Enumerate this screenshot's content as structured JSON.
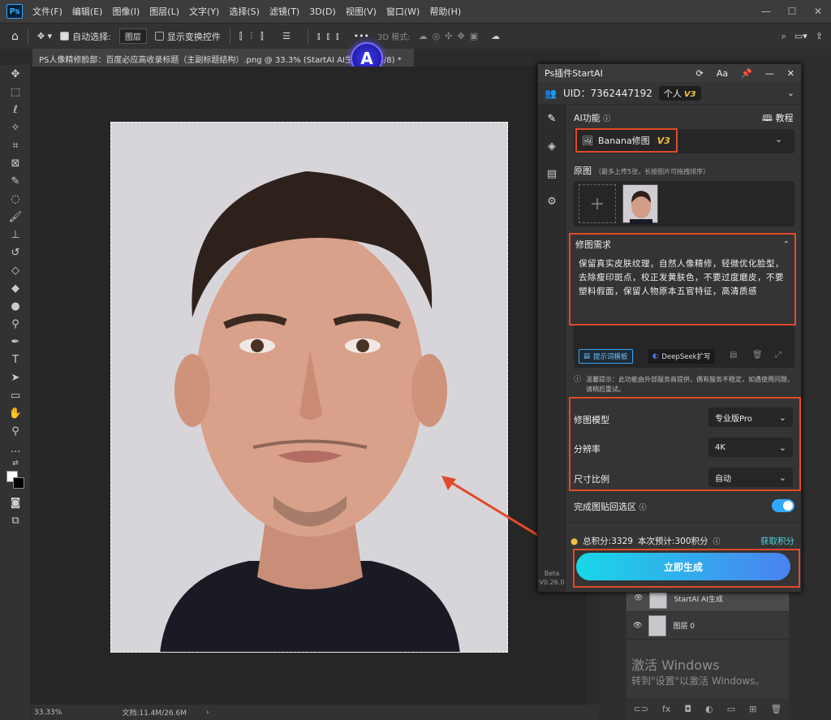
{
  "menubar": {
    "items": [
      "文件(F)",
      "编辑(E)",
      "图像(I)",
      "图层(L)",
      "文字(Y)",
      "选择(S)",
      "滤镜(T)",
      "3D(D)",
      "视图(V)",
      "窗口(W)",
      "帮助(H)"
    ],
    "logo": "Ps"
  },
  "options": {
    "auto_select": "自动选择:",
    "layer_select": "图层",
    "transform": "显示变换控件",
    "mode3d": "3D 模式:",
    "more": "•••"
  },
  "document": {
    "tab_title": "PS人像精修脸部：百度必应高收录标题（主副标题结构）.png @ 33.3% (StartAI AI生成, RGB/8) *",
    "zoom": "33.33%",
    "doc_info": "文档:11.4M/26.6M"
  },
  "plugin": {
    "title": "Ps插件StartAI",
    "uid": "UID：7362447192",
    "plan": "个人",
    "plan_ver": "V3",
    "ai_func_label": "AI功能",
    "tutorial": "教程",
    "func_selected": "Banana修图",
    "func_ver": "V3",
    "source_label": "原图",
    "source_hint": "（最多上传5张，长按图片可拖拽排序）",
    "req_label": "修图需求",
    "req_text": "保留真实皮肤纹理，自然人像精修，轻微优化脸型，去除瘦印斑点，校正发黄肤色，不要过度磨皮，不要塑料假面，保留人物原本五官特征，高清质感",
    "tpl_btn": "提示词模板",
    "ds_btn": "DeepSeek扩写",
    "notice": "温馨提示：此功能由外部服务商提供，偶有服务不稳定，如遇使用问题，请稍后重试。",
    "model_label": "修图模型",
    "model_value": "专业版Pro",
    "res_label": "分辨率",
    "res_value": "4K",
    "ratio_label": "尺寸比例",
    "ratio_value": "自动",
    "paste_label": "完成图贴回选区",
    "points": "总积分:3329",
    "estimate": "本次预计:300积分",
    "get_points": "获取积分",
    "generate": "立即生成",
    "beta": "Beta",
    "version": "V0.26.0"
  },
  "layers": [
    {
      "name": "StartAI AI生成"
    },
    {
      "name": "图层 0"
    }
  ],
  "watermark": {
    "line1": "激活 Windows",
    "line2": "转到\"设置\"以激活 Windows。"
  },
  "colors": {
    "accent": "#31a8ff",
    "highlight": "#e24a2b",
    "gold": "#f0c040"
  }
}
